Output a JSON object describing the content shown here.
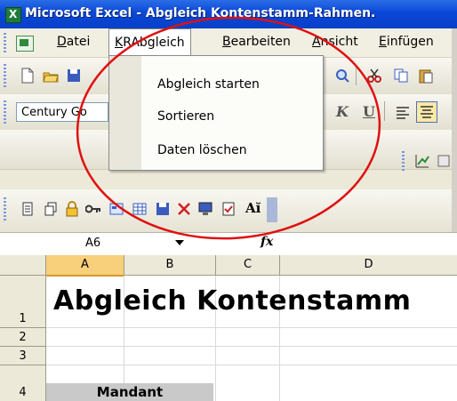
{
  "window": {
    "title": "Microsoft Excel - Abgleich Kontenstamm-Rahmen."
  },
  "menubar": {
    "items": [
      {
        "label": "Datei",
        "underline": "D",
        "rest": "atei"
      },
      {
        "label": "KRAbgleich",
        "underline": "K",
        "rest": "RAbgleich"
      },
      {
        "label": "Bearbeiten",
        "underline": "B",
        "rest": "earbeiten"
      },
      {
        "label": "Ansicht",
        "underline": "A",
        "rest": "nsicht"
      },
      {
        "label": "Einfügen",
        "underline": "E",
        "rest": "infügen"
      }
    ]
  },
  "dropdown": {
    "items": [
      "Abgleich starten",
      "Sortieren",
      "Daten löschen"
    ]
  },
  "format_toolbar": {
    "font_name": "Century Go"
  },
  "formula_bar": {
    "namebox_value": "A6",
    "fx_label": "fx"
  },
  "sheet": {
    "columns": [
      "A",
      "B",
      "C",
      "D"
    ],
    "rows": [
      "1",
      "2",
      "3",
      "4"
    ],
    "cells": {
      "A1": "Abgleich Kontenstamm",
      "A4": "Mandant"
    }
  },
  "colors": {
    "annotation_ellipse": "#e01010",
    "titlebar": "#0a46d6",
    "selected_header": "#f8cf7a"
  }
}
